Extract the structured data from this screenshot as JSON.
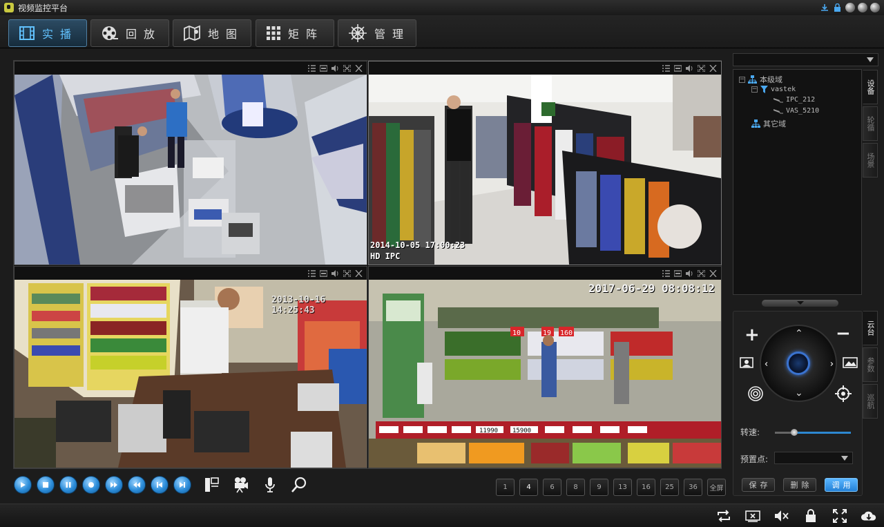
{
  "app": {
    "title": "视频监控平台"
  },
  "nav": {
    "tabs": [
      {
        "label": "实播",
        "icon": "film-icon"
      },
      {
        "label": "回放",
        "icon": "reel-icon"
      },
      {
        "label": "地图",
        "icon": "map-icon"
      },
      {
        "label": "矩阵",
        "icon": "grid-icon"
      },
      {
        "label": "管理",
        "icon": "helm-icon"
      }
    ],
    "active": "实播"
  },
  "video": {
    "panes": [
      {
        "timestamp": "",
        "label": "",
        "scene": "electronics store"
      },
      {
        "timestamp": "2014-10-05 17:00:23",
        "label": "HD IPC",
        "scene": "clothing store"
      },
      {
        "timestamp": "2013-10-16 14:25:43",
        "label": "",
        "scene": "convenience store checkout"
      },
      {
        "timestamp": "2017-06-29 08:08:12",
        "label": "",
        "scene": "supermarket produce"
      }
    ],
    "produce_prices": [
      "10",
      "19",
      "160"
    ],
    "bottom_price_tags": [
      "11990",
      "15900"
    ]
  },
  "layouts": [
    "1",
    "4",
    "6",
    "8",
    "9",
    "13",
    "16",
    "25",
    "36",
    "全屏"
  ],
  "layout_selected": "4",
  "tree": {
    "root": "本级域",
    "group": "vastek",
    "devices": [
      "IPC_212",
      "VAS_5210"
    ],
    "other": "其它域"
  },
  "side_tabs_top": [
    "设备",
    "轮循",
    "场景"
  ],
  "side_tabs_bottom": [
    "云台",
    "参数",
    "巡航"
  ],
  "ptz": {
    "speed_label": "转速:",
    "speed_value": 0.25,
    "preset_label": "预置点:",
    "preset_value": "",
    "save": "保存",
    "delete": "删除",
    "call": "调用"
  },
  "colors": {
    "accent": "#2d88d1",
    "active_tab": "#62c3ff",
    "background": "#1c1c1c"
  }
}
